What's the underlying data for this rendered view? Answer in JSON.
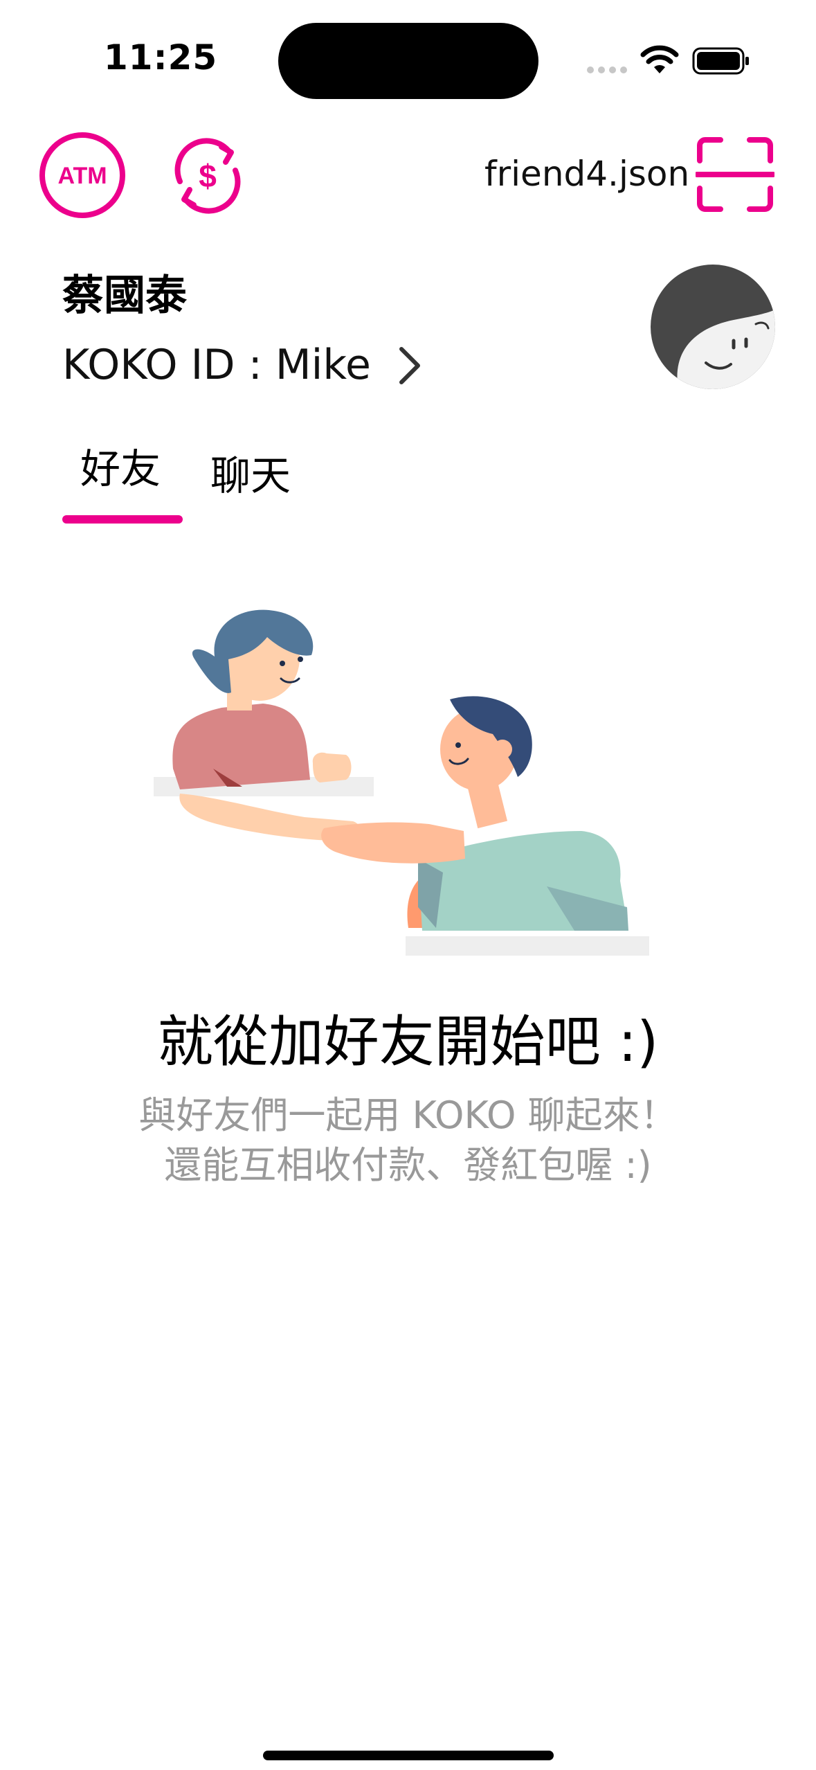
{
  "status_bar": {
    "time": "11:25",
    "icons": [
      "cellular-signal-icon",
      "wifi-icon",
      "battery-icon"
    ]
  },
  "toolbar": {
    "atm_label": "ATM",
    "transfer_icon": "currency-exchange-icon",
    "file_name": "friend4.json",
    "scan_icon": "qr-scan-icon"
  },
  "profile": {
    "name": "蔡國泰",
    "koko_id": "KOKO ID : Mike",
    "avatar_icon": "avatar-face-icon"
  },
  "tabs": [
    {
      "label": "好友",
      "selected": true
    },
    {
      "label": "聊天",
      "selected": false
    }
  ],
  "empty_state": {
    "illustration": "handshake-illustration",
    "title": "就從加好友開始吧 :)",
    "description_line1": "與好友們一起用 KOKO 聊起來！",
    "description_line2": "還能互相收付款、發紅包喔 :)"
  },
  "colors": {
    "accent": "#EC008C",
    "text_primary": "#000000",
    "text_secondary": "#999999"
  }
}
